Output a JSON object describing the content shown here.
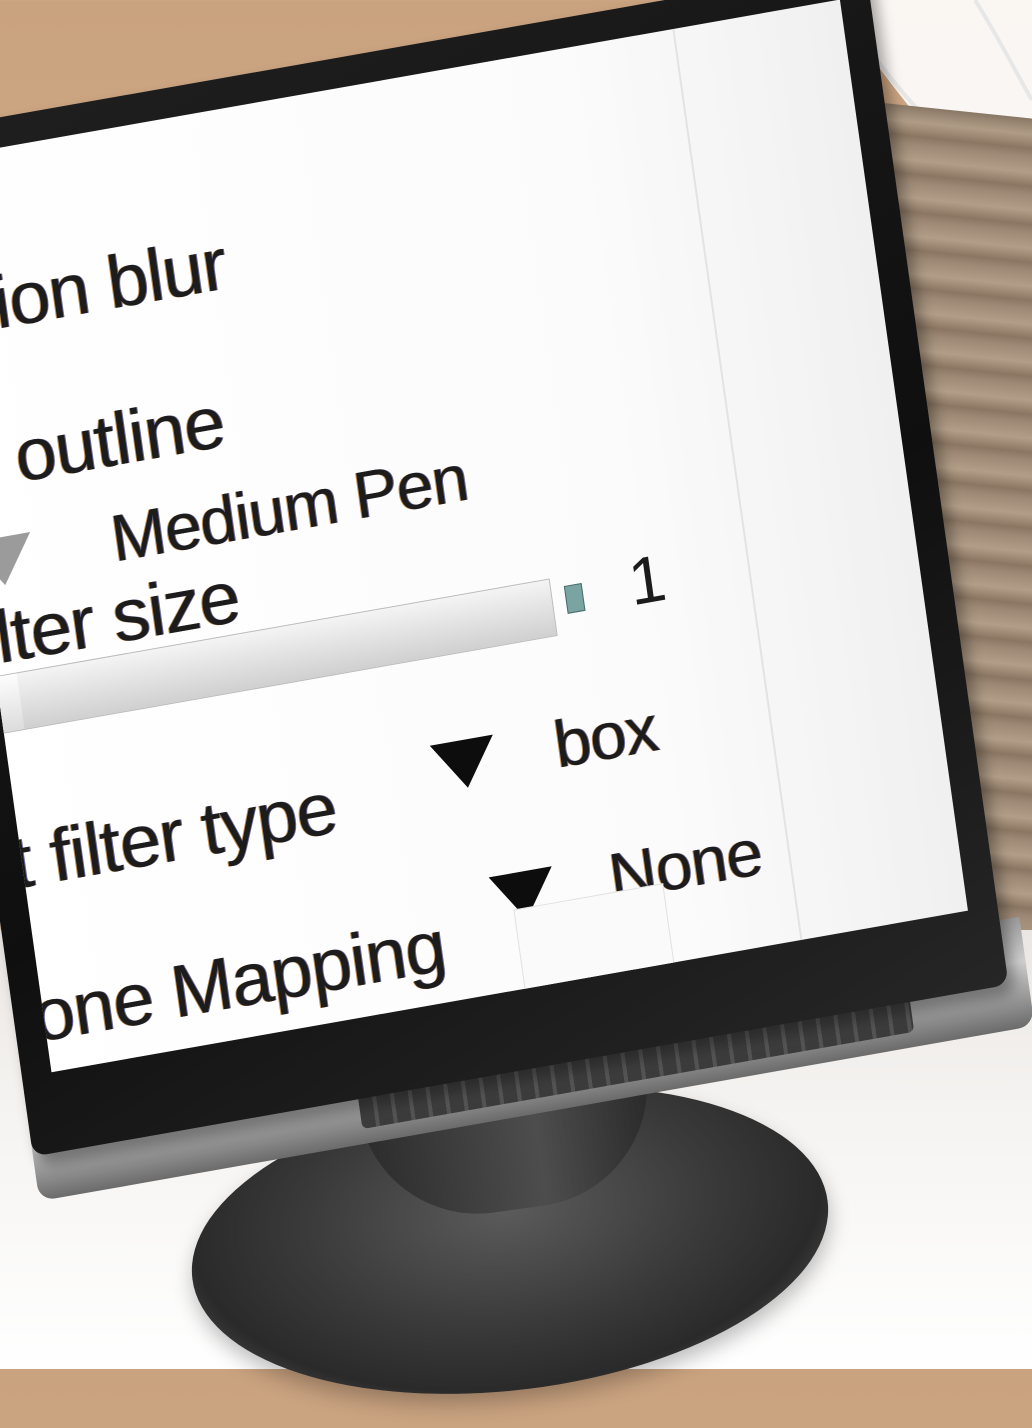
{
  "render_settings": {
    "motion_blur_label": "otion blur",
    "pen_outline_label": "n outline",
    "pen_outline_value": "Medium Pen",
    "filter_size_label": "ilter size",
    "filter_size_value": "1",
    "filter_size_fraction": 0.1,
    "pixel_filter_type_label": "t filter type",
    "pixel_filter_type_value": "box",
    "tone_mapping_label": "one Mapping",
    "tone_mapping_value": "None"
  },
  "colors": {
    "wall": "#cfa988",
    "screen_bg": "#ffffff",
    "text": "#1c1c1c",
    "slider_handle": "#7aa4a2",
    "bezel": "#141414",
    "desk": "#f3f1ef"
  },
  "icons": {
    "dropdown_arrow": "triangle-down",
    "disabled_dropdown_arrow": "triangle-down-grey"
  }
}
